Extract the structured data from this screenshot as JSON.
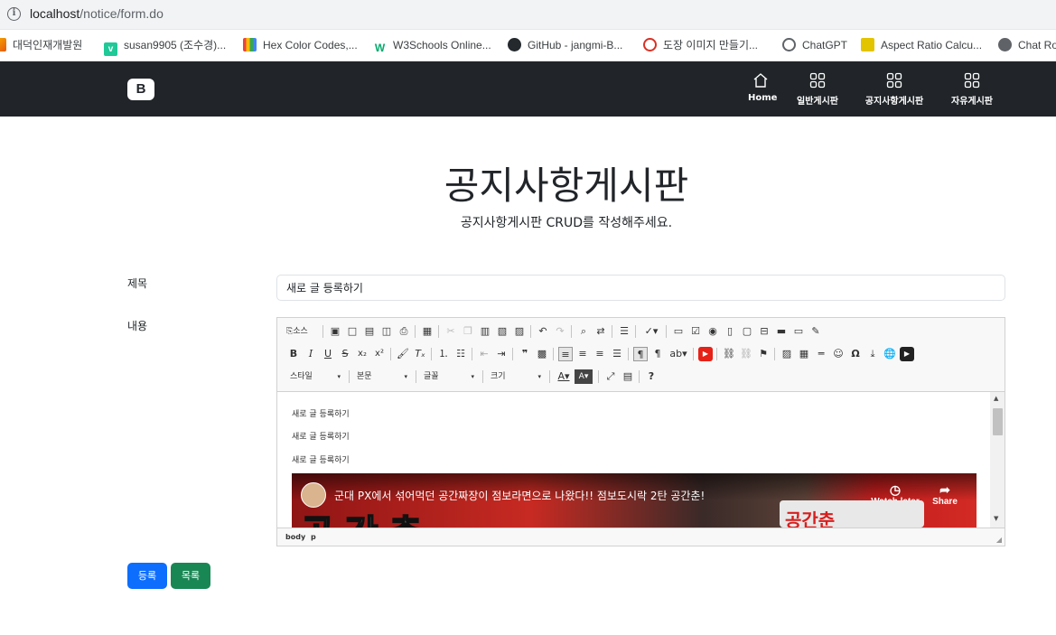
{
  "browser": {
    "url_host": "localhost",
    "url_path": "/notice/form.do",
    "bookmarks": [
      {
        "label": "대덕인재개발원",
        "icon": "flame-icon",
        "color": "#f28b00"
      },
      {
        "label": "susan9905 (조수경)...",
        "icon": "velog-icon",
        "color": "#20c997"
      },
      {
        "label": "Hex Color Codes,...",
        "icon": "palette-icon",
        "color": "#e8453c"
      },
      {
        "label": "W3Schools Online...",
        "icon": "w3-icon",
        "color": "#04aa6d"
      },
      {
        "label": "GitHub - jangmi-B...",
        "icon": "github-icon",
        "color": "#24292e"
      },
      {
        "label": "도장 이미지 만들기...",
        "icon": "stamp-icon",
        "color": "#d93025"
      },
      {
        "label": "ChatGPT",
        "icon": "chatgpt-icon",
        "color": "#5f6368"
      },
      {
        "label": "Aspect Ratio Calcu...",
        "icon": "ratio-icon",
        "color": "#e3c400"
      },
      {
        "label": "Chat Ro",
        "icon": "globe-icon",
        "color": "#5f6368"
      }
    ]
  },
  "navbar": {
    "brand": "B",
    "items": [
      {
        "label": "Home",
        "icon": "home-icon"
      },
      {
        "label": "일반게시판",
        "icon": "grid-icon"
      },
      {
        "label": "공지사항게시판",
        "icon": "grid-icon"
      },
      {
        "label": "자유게시판",
        "icon": "grid-icon"
      }
    ]
  },
  "header": {
    "title": "공지사항게시판",
    "subtitle": "공지사항게시판 CRUD를 작성해주세요."
  },
  "form": {
    "title_label": "제목",
    "title_value": "새로 글 등록하기",
    "content_label": "내용"
  },
  "editor": {
    "source_label": "소스",
    "combos": {
      "style": "스타일",
      "format": "본문",
      "font": "글꼴",
      "size": "크기"
    },
    "paragraphs": [
      "새로 글 등록하기",
      "새로 글 등록하기",
      "새로 글 등록하기"
    ],
    "video_title": "군대 PX에서 섞어먹던 공간짜장이 점보라면으로 나왔다!! 점보도시락 2탄 공간춘!",
    "video_watch_later": "Watch later",
    "video_share": "Share",
    "video_brand_text": "공간춘",
    "status_path": [
      "body",
      "p"
    ]
  },
  "buttons": {
    "submit": "등록",
    "list": "목록"
  },
  "colors": {
    "navbar_bg": "#212529",
    "primary": "#0d6efd",
    "success": "#198754",
    "video_red": "#b51f1f"
  }
}
